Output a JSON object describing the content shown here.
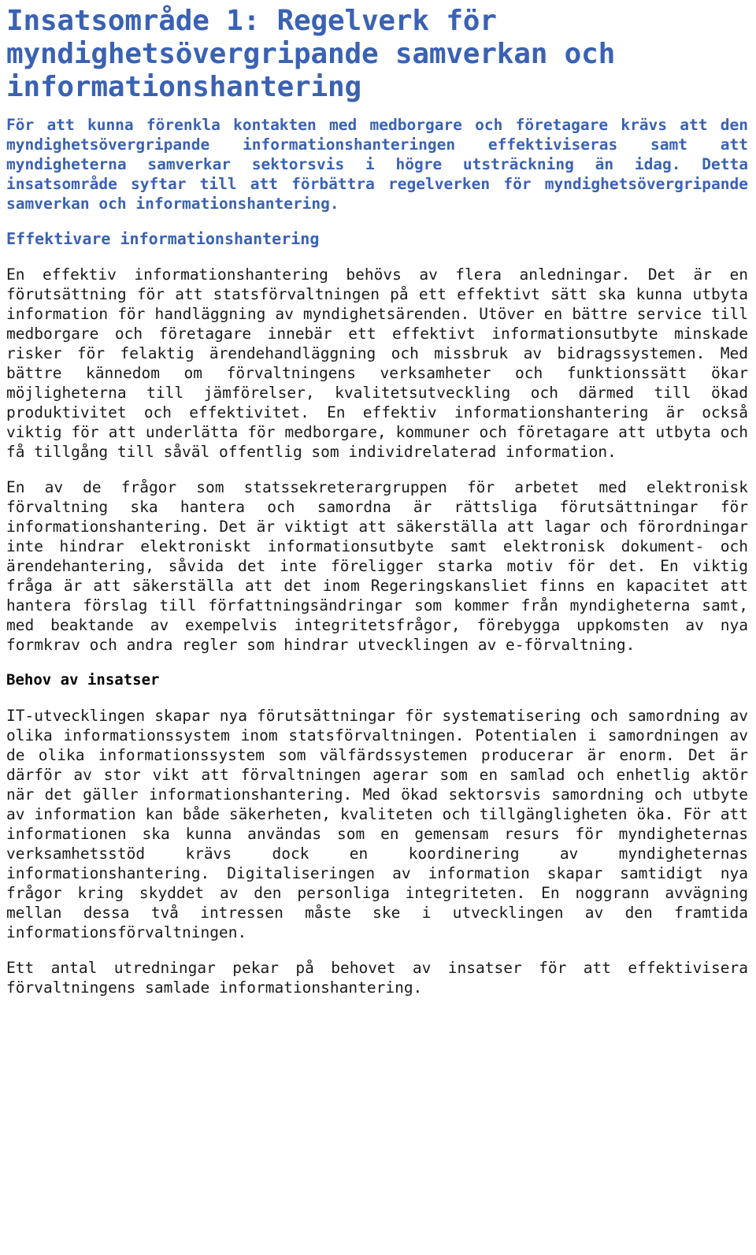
{
  "document": {
    "language": "sv",
    "accent_color": "#3A62B3",
    "body_color": "#1a1a1a",
    "background_color": "#ffffff",
    "title": "Insatsområde 1: Regelverk för myndighetsövergripande samverkan och informationshantering",
    "intro": "För att kunna förenkla kontakten med medborgare och företagare krävs att den myndighetsövergripande informationshanteringen effektiviseras samt att myndigheterna samverkar sektorsvis i högre utsträckning än idag. Detta insatsområde syftar till att förbättra regelverken för myndighetsövergripande samverkan och informationshantering.",
    "sections": [
      {
        "heading": "Effektivare informationshantering",
        "heading_color": "#3A62B3",
        "paragraphs": [
          "En effektiv informationshantering behövs av flera anledningar. Det är en förutsättning för att statsförvaltningen på ett effektivt sätt ska kunna utbyta information för handläggning av myndighetsärenden. Utöver en bättre service till medborgare och företagare innebär ett effektivt informationsutbyte minskade risker för felaktig ärendehandläggning och missbruk av bidragssystemen. Med bättre kännedom om förvaltningens verksamheter och funktionssätt ökar möjligheterna till jämförelser, kvalitetsutveckling och därmed till ökad produktivitet och effektivitet. En effektiv informationshantering är också viktig för att underlätta för medborgare, kommuner och företagare att utbyta och få tillgång till såväl offentlig som individrelaterad information.",
          "En av de frågor som statssekreterargruppen för arbetet med elektronisk förvaltning ska hantera och samordna är rättsliga förutsättningar för informationshantering. Det är viktigt att säkerställa att lagar och förordningar inte hindrar elektroniskt informationsutbyte samt elektronisk dokument- och ärendehantering, såvida det inte föreligger starka motiv för det. En viktig fråga är att säkerställa att det inom Regeringskansliet finns en kapacitet att hantera förslag till författningsändringar som kommer från myndigheterna samt, med beaktande av exempelvis integritetsfrågor, förebygga uppkomsten av nya formkrav och andra regler som hindrar utvecklingen av e-förvaltning."
        ]
      },
      {
        "heading": "Behov av insatser",
        "heading_color": "#000000",
        "paragraphs": [
          "IT-utvecklingen skapar nya förutsättningar för systematisering och samordning av olika informationssystem inom statsförvaltningen. Potentialen i samordningen av de olika informationssystem som välfärdssystemen producerar är enorm. Det är därför av stor vikt att förvaltningen agerar som en samlad och enhetlig aktör när det gäller informationshantering. Med ökad sektorsvis samordning och utbyte av information kan både säkerheten, kvaliteten och tillgängligheten öka. För att informationen ska kunna användas som en gemensam resurs för myndigheternas verksamhetsstöd krävs dock en koordinering av myndigheternas informationshantering. Digitaliseringen av information skapar samtidigt nya frågor kring skyddet av den personliga integriteten. En noggrann avvägning mellan dessa två intressen måste ske i utvecklingen av den framtida informationsförvaltningen.",
          "Ett antal utredningar pekar på behovet av insatser för att effektivisera förvaltningens samlade informationshantering."
        ]
      }
    ]
  }
}
